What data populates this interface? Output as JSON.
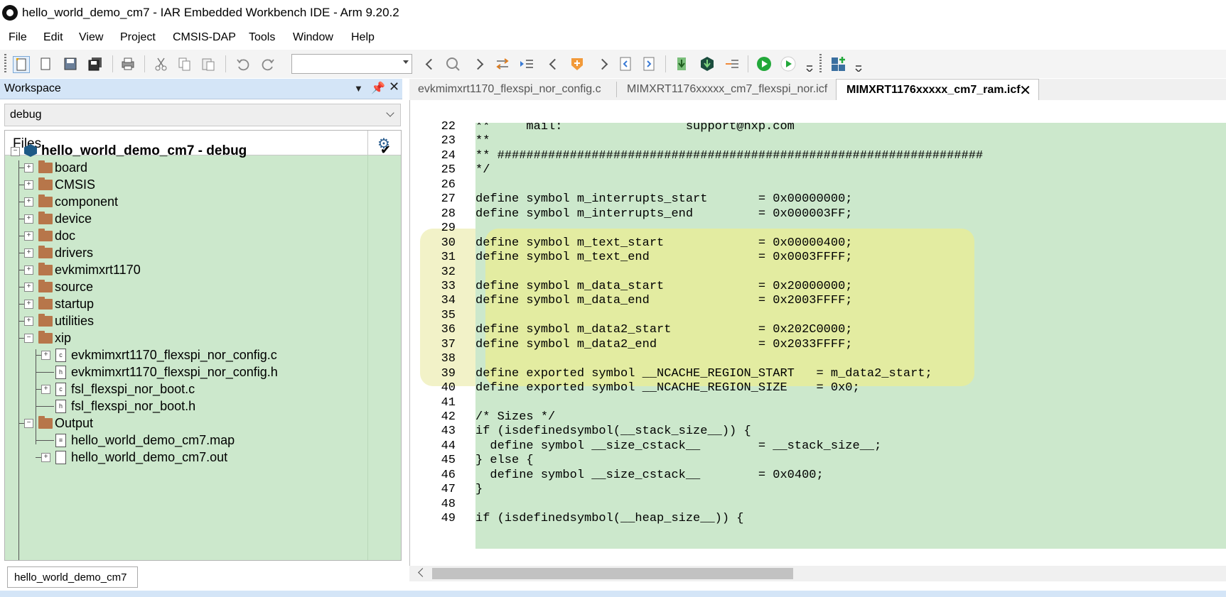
{
  "window": {
    "title": "hello_world_demo_cm7 - IAR Embedded Workbench IDE - Arm 9.20.2"
  },
  "menu": [
    "File",
    "Edit",
    "View",
    "Project",
    "CMSIS-DAP",
    "Tools",
    "Window",
    "Help"
  ],
  "toolbar": {
    "combo_value": ""
  },
  "workspace": {
    "title": "Workspace",
    "config": "debug",
    "files_label": "Files",
    "project": "hello_world_demo_cm7 - debug",
    "items": [
      {
        "label": "board",
        "type": "folder",
        "level": 1,
        "expander": "+"
      },
      {
        "label": "CMSIS",
        "type": "folder",
        "level": 1,
        "expander": "+"
      },
      {
        "label": "component",
        "type": "folder",
        "level": 1,
        "expander": "+"
      },
      {
        "label": "device",
        "type": "folder",
        "level": 1,
        "expander": "+"
      },
      {
        "label": "doc",
        "type": "folder",
        "level": 1,
        "expander": "+"
      },
      {
        "label": "drivers",
        "type": "folder",
        "level": 1,
        "expander": "+"
      },
      {
        "label": "evkmimxrt1170",
        "type": "folder",
        "level": 1,
        "expander": "+"
      },
      {
        "label": "source",
        "type": "folder",
        "level": 1,
        "expander": "+"
      },
      {
        "label": "startup",
        "type": "folder",
        "level": 1,
        "expander": "+"
      },
      {
        "label": "utilities",
        "type": "folder",
        "level": 1,
        "expander": "+"
      },
      {
        "label": "xip",
        "type": "folder",
        "level": 1,
        "expander": "−"
      },
      {
        "label": "evkmimxrt1170_flexspi_nor_config.c",
        "type": "c",
        "level": 2,
        "expander": "+"
      },
      {
        "label": "evkmimxrt1170_flexspi_nor_config.h",
        "type": "h",
        "level": 2,
        "expander": ""
      },
      {
        "label": "fsl_flexspi_nor_boot.c",
        "type": "c",
        "level": 2,
        "expander": "+"
      },
      {
        "label": "fsl_flexspi_nor_boot.h",
        "type": "h",
        "level": 2,
        "expander": ""
      },
      {
        "label": "Output",
        "type": "folder",
        "level": 1,
        "expander": "−"
      },
      {
        "label": "hello_world_demo_cm7.map",
        "type": "map",
        "level": 2,
        "expander": ""
      },
      {
        "label": "hello_world_demo_cm7.out",
        "type": "out",
        "level": 2,
        "expander": "+"
      }
    ],
    "bottom_tab": "hello_world_demo_cm7"
  },
  "editor": {
    "tabs": [
      {
        "label": "evkmimxrt1170_flexspi_nor_config.c",
        "active": false
      },
      {
        "label": "MIMXRT1176xxxxx_cm7_flexspi_nor.icf",
        "active": false
      },
      {
        "label": "MIMXRT1176xxxxx_cm7_ram.icf",
        "active": true
      }
    ],
    "lines": [
      {
        "n": "22",
        "code": "**     mail:                 support@nxp.com"
      },
      {
        "n": "23",
        "code": "**"
      },
      {
        "n": "24",
        "code": "** ###################################################################"
      },
      {
        "n": "25",
        "code": "*/"
      },
      {
        "n": "26",
        "code": ""
      },
      {
        "n": "27",
        "code": "define symbol m_interrupts_start       = 0x00000000;"
      },
      {
        "n": "28",
        "code": "define symbol m_interrupts_end         = 0x000003FF;"
      },
      {
        "n": "29",
        "code": ""
      },
      {
        "n": "30",
        "code": "define symbol m_text_start             = 0x00000400;"
      },
      {
        "n": "31",
        "code": "define symbol m_text_end               = 0x0003FFFF;"
      },
      {
        "n": "32",
        "code": ""
      },
      {
        "n": "33",
        "code": "define symbol m_data_start             = 0x20000000;"
      },
      {
        "n": "34",
        "code": "define symbol m_data_end               = 0x2003FFFF;"
      },
      {
        "n": "35",
        "code": ""
      },
      {
        "n": "36",
        "code": "define symbol m_data2_start            = 0x202C0000;"
      },
      {
        "n": "37",
        "code": "define symbol m_data2_end              = 0x2033FFFF;"
      },
      {
        "n": "38",
        "code": ""
      },
      {
        "n": "39",
        "code": "define exported symbol __NCACHE_REGION_START   = m_data2_start;"
      },
      {
        "n": "40",
        "code": "define exported symbol __NCACHE_REGION_SIZE    = 0x0;"
      },
      {
        "n": "41",
        "code": ""
      },
      {
        "n": "42",
        "code": "/* Sizes */"
      },
      {
        "n": "43",
        "code": "if (isdefinedsymbol(__stack_size__)) {"
      },
      {
        "n": "44",
        "code": "  define symbol __size_cstack__        = __stack_size__;"
      },
      {
        "n": "45",
        "code": "} else {"
      },
      {
        "n": "46",
        "code": "  define symbol __size_cstack__        = 0x0400;"
      },
      {
        "n": "47",
        "code": "}"
      },
      {
        "n": "48",
        "code": ""
      },
      {
        "n": "49",
        "code": "if (isdefinedsymbol(__heap_size__)) {"
      }
    ]
  },
  "colors": {
    "code_bg": "#cce8cc",
    "highlight": "#e6ec99",
    "header_bg": "#d4e5f7"
  }
}
